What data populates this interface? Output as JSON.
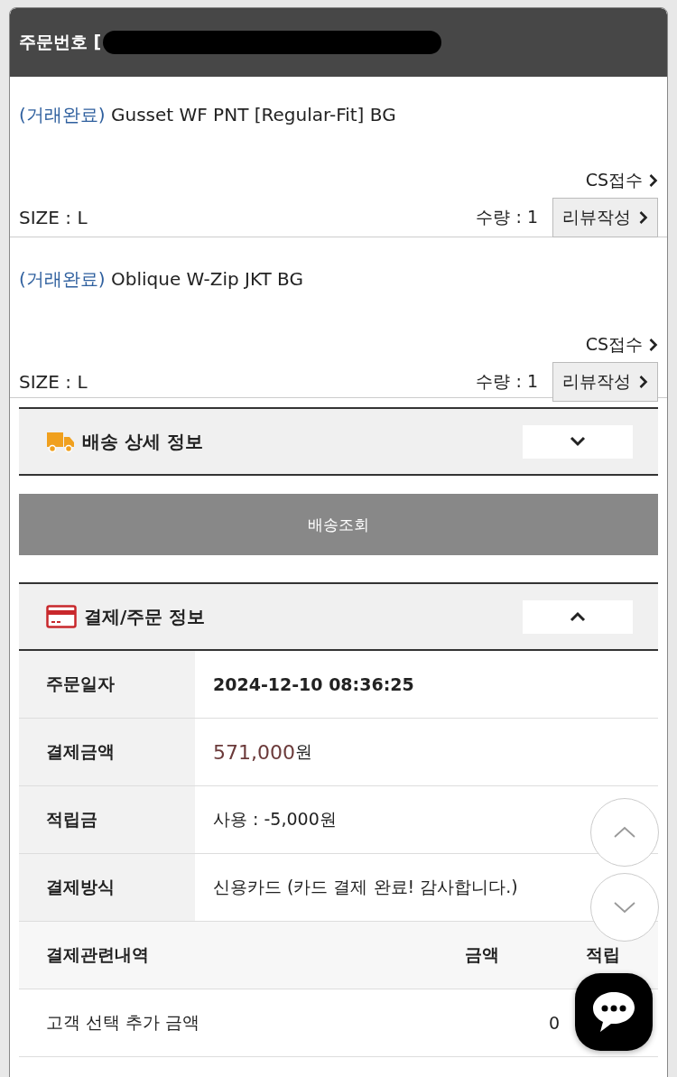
{
  "header": {
    "title": "주문번호 ["
  },
  "items": [
    {
      "status": "(거래완료)",
      "name": "Gusset WF PNT [Regular-Fit] BG",
      "cs": "CS접수",
      "size": "SIZE : L",
      "qty": "수량 : 1",
      "review": "리뷰작성"
    },
    {
      "status": "(거래완료)",
      "name": "Oblique W-Zip JKT BG",
      "cs": "CS접수",
      "size": "SIZE : L",
      "qty": "수량 : 1",
      "review": "리뷰작성"
    }
  ],
  "shipping": {
    "title": "배송 상세 정보",
    "expanded": false,
    "track_button": "배송조회"
  },
  "payment": {
    "title": "결제/주문 정보",
    "expanded": true,
    "rows": [
      {
        "label": "주문일자",
        "value": "2024-12-10 08:36:25",
        "kind": "bold"
      },
      {
        "label": "결제금액",
        "value": "571,000",
        "unit": "원",
        "kind": "price"
      },
      {
        "label": "적립금",
        "value": "사용 : -5,000원",
        "kind": "plain"
      },
      {
        "label": "결제방식",
        "value": "신용카드 (카드 결제 완료! 감사합니다.)",
        "kind": "plain"
      }
    ],
    "columns": [
      "결제관련내역",
      "금액",
      "적립"
    ],
    "detail_rows": [
      [
        "고객 선택 추가 금액",
        "0"
      ]
    ]
  }
}
